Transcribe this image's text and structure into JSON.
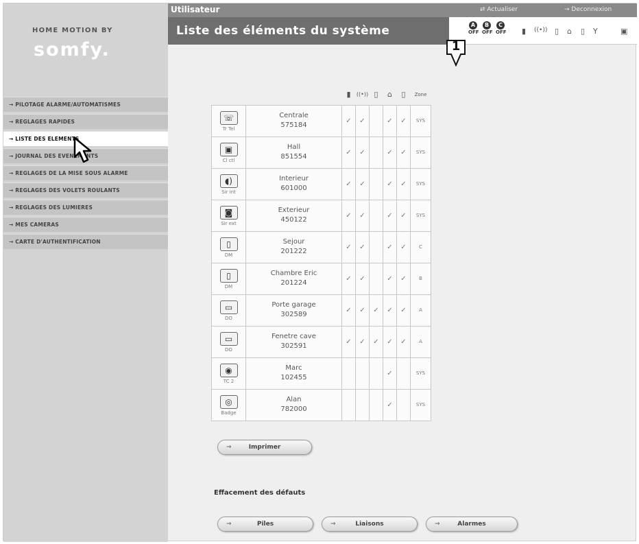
{
  "brand": {
    "top": "HOME MOTION BY",
    "name": "somfy."
  },
  "topbar": {
    "user": "Utilisateur",
    "refresh": "Actualiser",
    "logout": "Deconnexion"
  },
  "title": "Liste des éléments du système",
  "status": {
    "zones": [
      {
        "letter": "A",
        "state": "OFF"
      },
      {
        "letter": "B",
        "state": "OFF"
      },
      {
        "letter": "C",
        "state": "OFF"
      }
    ]
  },
  "menu": [
    {
      "label": "→ PILOTAGE ALARME/AUTOMATISMES"
    },
    {
      "label": "→ REGLAGES RAPIDES"
    },
    {
      "label": "→ LISTE DES ELEMENTS",
      "selected": true
    },
    {
      "label": "→ JOURNAL DES EVENEMENTS"
    },
    {
      "label": "→ REGLAGES DE LA MISE SOUS ALARME"
    },
    {
      "label": "→ REGLAGES DES VOLETS ROULANTS"
    },
    {
      "label": "→ REGLAGES DES LUMIERES"
    },
    {
      "label": "→ MES CAMERAS"
    },
    {
      "label": "→ CARTE D'AUTHENTIFICATION"
    }
  ],
  "callout": "1",
  "table": {
    "zone_header": "Zone",
    "check": "✓",
    "rows": [
      {
        "icon": "☏",
        "code": "Tr Tel",
        "name": "Centrale",
        "id": "575184",
        "checks": [
          1,
          1,
          0,
          1,
          1
        ],
        "zone": "SYS"
      },
      {
        "icon": "▣",
        "code": "Cl ctl",
        "name": "Hall",
        "id": "851554",
        "checks": [
          1,
          1,
          0,
          1,
          1
        ],
        "zone": "SYS"
      },
      {
        "icon": "◖)",
        "code": "Sir int",
        "name": "Interieur",
        "id": "601000",
        "checks": [
          1,
          1,
          0,
          1,
          1
        ],
        "zone": "SYS"
      },
      {
        "icon": "◙",
        "code": "Sir ext",
        "name": "Exterieur",
        "id": "450122",
        "checks": [
          1,
          1,
          0,
          1,
          1
        ],
        "zone": "SYS"
      },
      {
        "icon": "▯",
        "code": "DM",
        "name": "Sejour",
        "id": "201222",
        "checks": [
          1,
          1,
          0,
          1,
          1
        ],
        "zone": "C"
      },
      {
        "icon": "▯",
        "code": "DM",
        "name": "Chambre Eric",
        "id": "201224",
        "checks": [
          1,
          1,
          0,
          1,
          1
        ],
        "zone": "B"
      },
      {
        "icon": "▭",
        "code": "DO",
        "name": "Porte garage",
        "id": "302589",
        "checks": [
          1,
          1,
          1,
          1,
          1
        ],
        "zone": "A"
      },
      {
        "icon": "▭",
        "code": "DO",
        "name": "Fenetre cave",
        "id": "302591",
        "checks": [
          1,
          1,
          1,
          1,
          1
        ],
        "zone": "A"
      },
      {
        "icon": "◉",
        "code": "TC 2",
        "name": "Marc",
        "id": "102455",
        "checks": [
          0,
          0,
          0,
          1,
          0
        ],
        "zone": "SYS"
      },
      {
        "icon": "◎",
        "code": "Badge",
        "name": "Alan",
        "id": "782000",
        "checks": [
          0,
          0,
          0,
          1,
          0
        ],
        "zone": "SYS"
      }
    ]
  },
  "buttons": {
    "print": "Imprimer",
    "batteries": "Piles",
    "links": "Liaisons",
    "alarms": "Alarmes"
  },
  "clear_faults_title": "Effacement des défauts"
}
